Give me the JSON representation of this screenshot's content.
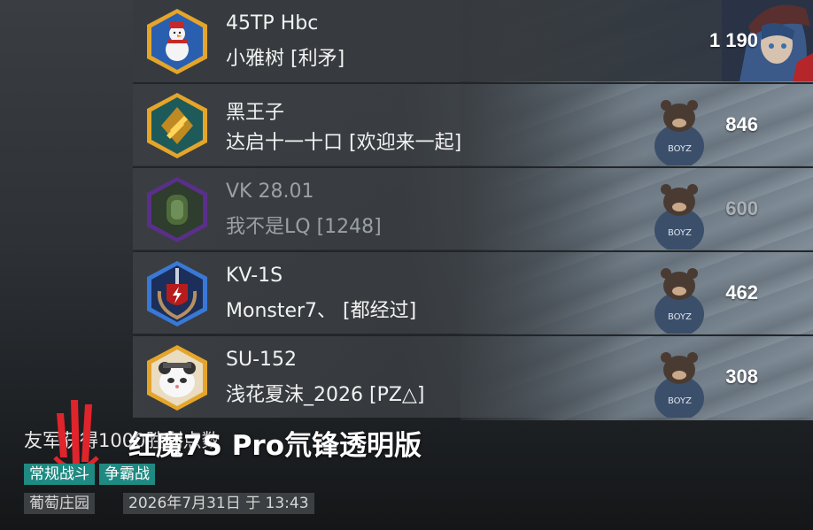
{
  "players": [
    {
      "name": "45TP Hbc",
      "clan": "小雅树 [利矛]",
      "score": "1 190",
      "avatar_icon": "snowman-badge-icon",
      "dim": false
    },
    {
      "name": "黑王子",
      "clan": "达启十一十口 [欢迎来一起]",
      "score": "846",
      "avatar_icon": "gold-chevron-badge-icon",
      "dim": false
    },
    {
      "name": "VK 28.01",
      "clan": "我不是LQ [1248]",
      "score": "600",
      "avatar_icon": "forest-shrine-badge-icon",
      "dim": true
    },
    {
      "name": "KV-1S",
      "clan": "Monster7、 [都经过]",
      "score": "462",
      "avatar_icon": "lightning-shield-badge-icon",
      "dim": false
    },
    {
      "name": "SU-152",
      "clan": "浅花夏沫_2026 [PZ△]",
      "score": "308",
      "avatar_icon": "panda-cat-badge-icon",
      "dim": false
    }
  ],
  "battle": {
    "result_text": "友军获得1000胜利点数",
    "watermark": "红魔7S Pro氘锋透明版",
    "mode_tag": "常规战斗",
    "type_tag": "争霸战",
    "map": "葡萄庄园",
    "datetime": "2026年7月31日 于 13:43"
  },
  "colors": {
    "tag_bg": "#1f8a82",
    "gold_border": "#e5a52a",
    "purple_border": "#6f3fa8",
    "blue_border": "#3a78d6",
    "logo_red": "#e0242b"
  }
}
